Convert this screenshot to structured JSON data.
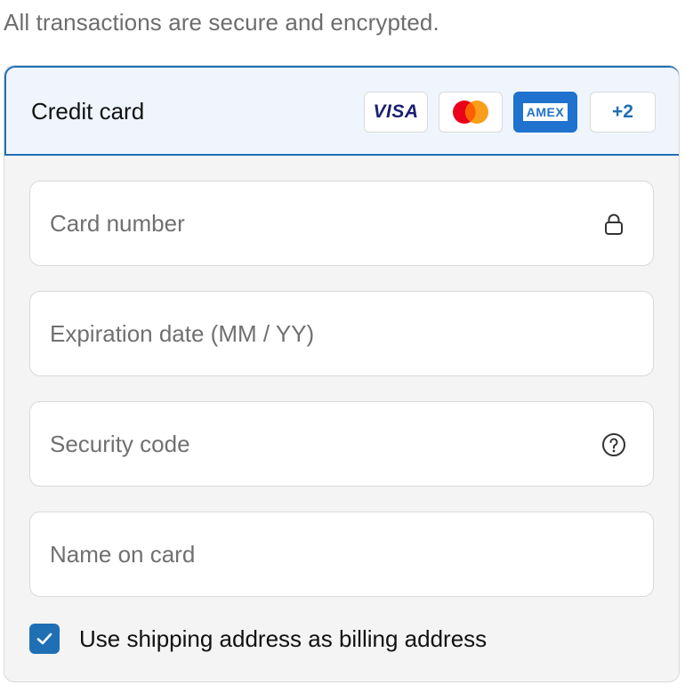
{
  "notice": "All transactions are secure and encrypted.",
  "payment": {
    "method_label": "Credit card",
    "badges": {
      "visa": "VISA",
      "mastercard_icon": "mastercard-icon",
      "amex": "AMEX",
      "more": "+2"
    }
  },
  "fields": {
    "card_number": {
      "placeholder": "Card number",
      "value": "",
      "icon": "lock-icon"
    },
    "expiration": {
      "placeholder": "Expiration date (MM / YY)",
      "value": ""
    },
    "security_code": {
      "placeholder": "Security code",
      "value": "",
      "icon": "help-circle-icon"
    },
    "name_on_card": {
      "placeholder": "Name on card",
      "value": ""
    }
  },
  "billing": {
    "checked": true,
    "label": "Use shipping address as billing address"
  },
  "colors": {
    "accent": "#1f6fb5",
    "header_bg": "#f0f5fd",
    "panel_bg": "#f4f4f4",
    "amex_blue": "#1f72cd",
    "visa_navy": "#1a1f71",
    "mastercard_red": "#eb001b",
    "mastercard_orange": "#f79e1b"
  }
}
